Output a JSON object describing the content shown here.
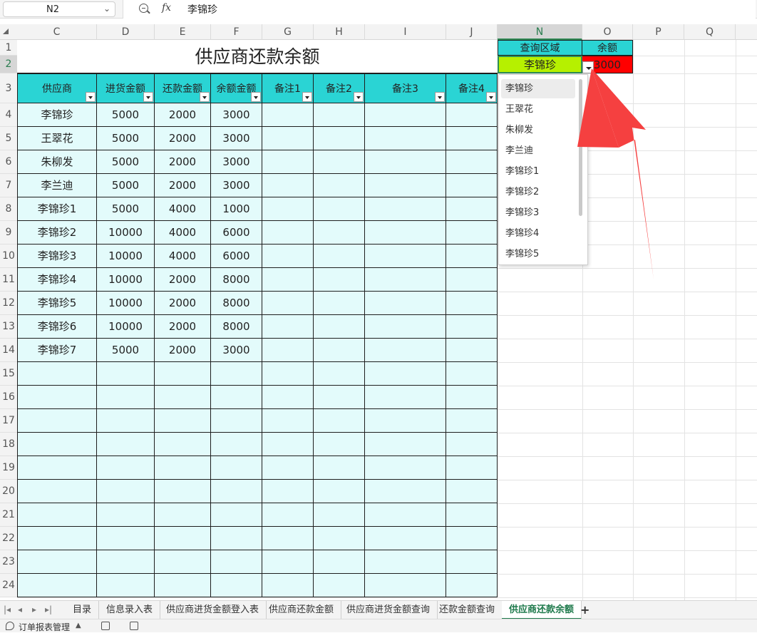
{
  "formula_bar": {
    "name_box": "N2",
    "function_label": "fx",
    "value": "李锦珍"
  },
  "columns": [
    "C",
    "D",
    "E",
    "F",
    "G",
    "H",
    "I",
    "J",
    "N",
    "O",
    "P",
    "Q"
  ],
  "rows": [
    "1",
    "2",
    "3",
    "4",
    "5",
    "6",
    "7",
    "8",
    "9",
    "10",
    "11",
    "12",
    "13",
    "14",
    "15",
    "16",
    "17",
    "18",
    "19",
    "20",
    "21",
    "22",
    "23",
    "24"
  ],
  "sheet": {
    "title": "供应商还款余额",
    "headers": [
      "供应商",
      "进货金额",
      "还款金额",
      "余额金额",
      "备注1",
      "备注2",
      "备注3",
      "备注4"
    ],
    "data_rows": [
      [
        "李锦珍",
        "5000",
        "2000",
        "3000"
      ],
      [
        "王翠花",
        "5000",
        "2000",
        "3000"
      ],
      [
        "朱柳发",
        "5000",
        "2000",
        "3000"
      ],
      [
        "李兰迪",
        "5000",
        "2000",
        "3000"
      ],
      [
        "李锦珍1",
        "5000",
        "4000",
        "1000"
      ],
      [
        "李锦珍2",
        "10000",
        "4000",
        "6000"
      ],
      [
        "李锦珍3",
        "10000",
        "4000",
        "6000"
      ],
      [
        "李锦珍4",
        "10000",
        "2000",
        "8000"
      ],
      [
        "李锦珍5",
        "10000",
        "2000",
        "8000"
      ],
      [
        "李锦珍6",
        "10000",
        "2000",
        "8000"
      ],
      [
        "李锦珍7",
        "5000",
        "2000",
        "3000"
      ]
    ]
  },
  "query": {
    "header_area": "查询区域",
    "header_balance": "余额",
    "selected_supplier": "李锦珍",
    "balance": "3000",
    "dropdown_options": [
      "李锦珍",
      "王翠花",
      "朱柳发",
      "李兰迪",
      "李锦珍1",
      "李锦珍2",
      "李锦珍3",
      "李锦珍4",
      "李锦珍5"
    ]
  },
  "tabs": [
    "目录",
    "信息录入表",
    "供应商进货金额登入表",
    "供应商还款金额",
    "供应商进货金额查询",
    "还款金额查询",
    "供应商还款余额"
  ],
  "active_tab": "供应商还款余额",
  "status": {
    "label": "订单报表管理"
  },
  "colors": {
    "header_cyan": "#2ad4d4",
    "cell_light": "#e3fbfb",
    "query_green": "#b6f000",
    "balance_red": "#ff0000",
    "arrow_red": "#f54040",
    "accent_green": "#1f7a4c"
  }
}
